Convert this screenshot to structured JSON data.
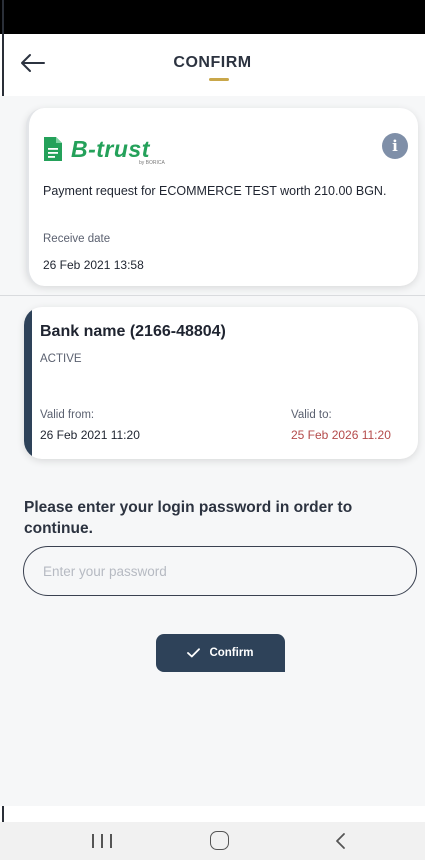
{
  "header": {
    "title": "CONFIRM",
    "back_icon": "arrow-left-icon",
    "accent_color": "#c9a74a"
  },
  "request_card": {
    "brand": "B-trust",
    "brand_sub": "by BORICA",
    "brand_color": "#24a15a",
    "info_icon": "i",
    "request_text": "Payment request for ECOMMERCE TEST worth 210.00 BGN.",
    "receive_label": "Receive date",
    "receive_value": "26 Feb 2021 13:58"
  },
  "account_card": {
    "bank_name": "Bank name (2166-48804)",
    "status": "ACTIVE",
    "valid_from_label": "Valid from:",
    "valid_from_value": "26 Feb 2021 11:20",
    "valid_to_label": "Valid to:",
    "valid_to_value": "25 Feb 2026 11:20",
    "accent_color": "#2e4259",
    "valid_to_color": "#b44a4a"
  },
  "password": {
    "prompt": "Please enter your login password in order to continue.",
    "placeholder": "Enter your password",
    "value": ""
  },
  "confirm_button": {
    "label": "Confirm",
    "icon": "check-icon",
    "color": "#2e4259"
  },
  "nav_bar": {
    "recents_icon": "recents-icon",
    "home_icon": "home-icon",
    "back_icon": "chevron-left-icon"
  }
}
